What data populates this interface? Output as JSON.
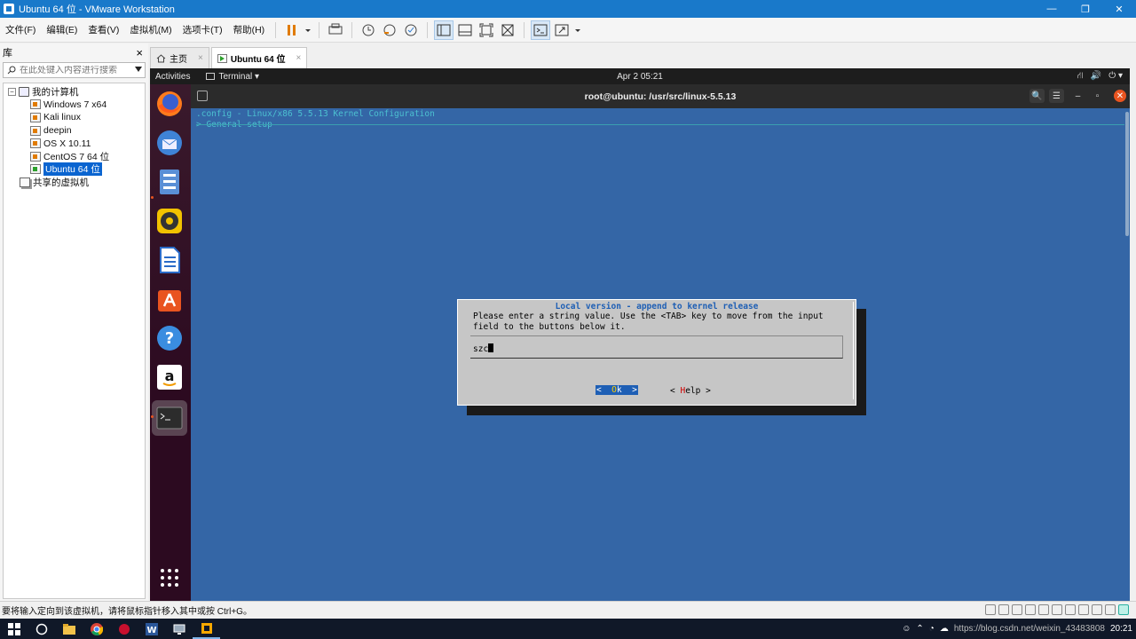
{
  "window": {
    "title": "Ubuntu 64 位 - VMware Workstation",
    "controls": [
      "—",
      "❐",
      "✕"
    ]
  },
  "menu": [
    "文件(F)",
    "编辑(E)",
    "查看(V)",
    "虚拟机(M)",
    "选项卡(T)",
    "帮助(H)"
  ],
  "library": {
    "header": "库",
    "close": "×",
    "search_placeholder": "在此处键入内容进行搜索",
    "root_toggle": "−",
    "root": "我的计算机",
    "vms": [
      {
        "name": "Windows 7 x64",
        "running": false,
        "selected": false
      },
      {
        "name": "Kali linux",
        "running": false,
        "selected": false
      },
      {
        "name": "deepin",
        "running": false,
        "selected": false
      },
      {
        "name": "OS X 10.11",
        "running": false,
        "selected": false
      },
      {
        "name": "CentOS 7 64 位",
        "running": false,
        "selected": false
      },
      {
        "name": "Ubuntu 64 位",
        "running": true,
        "selected": true
      }
    ],
    "shared": "共享的虚拟机"
  },
  "tabs": [
    {
      "label": "主页",
      "close": "×",
      "active": false
    },
    {
      "label": "Ubuntu 64 位",
      "close": "×",
      "active": true
    }
  ],
  "ubuntu": {
    "activities": "Activities",
    "app_menu": "Terminal ▾",
    "clock": "Apr 2  05:21",
    "sys_icons": [
      "⛙",
      "🔊",
      "⏻ ▾"
    ],
    "terminal_title": "root@ubuntu: /usr/src/linux-5.5.13",
    "terminal_controls": [
      "🔍",
      "☰",
      "–",
      "▫",
      "✕"
    ]
  },
  "menuconfig": {
    "title": ".config - Linux/x86 5.5.13 Kernel Configuration",
    "subtitle": "> General setup",
    "dialog_title": "Local version - append to kernel release",
    "dialog_text": "Please enter a string value. Use the <TAB> key to move from the input\nfield to the buttons below it.",
    "input_value": "szc",
    "ok_pre": "<  ",
    "ok_hotkey": "O",
    "ok_post": "k  >",
    "help_pre": "< ",
    "help_hotkey": "H",
    "help_post": "elp >"
  },
  "statusbar": {
    "text": "要将输入定向到该虚拟机，请将鼠标指针移入其中或按 Ctrl+G。"
  },
  "taskbar": {
    "tray_text": "20:21",
    "watermark": "https://blog.csdn.net/weixin_43483808"
  },
  "colors": {
    "vmware_blue": "#1979ca",
    "menuconfig_bg": "#3466a6",
    "dialog_bg": "#c6c6c6",
    "ubuntu_orange": "#e95420"
  }
}
